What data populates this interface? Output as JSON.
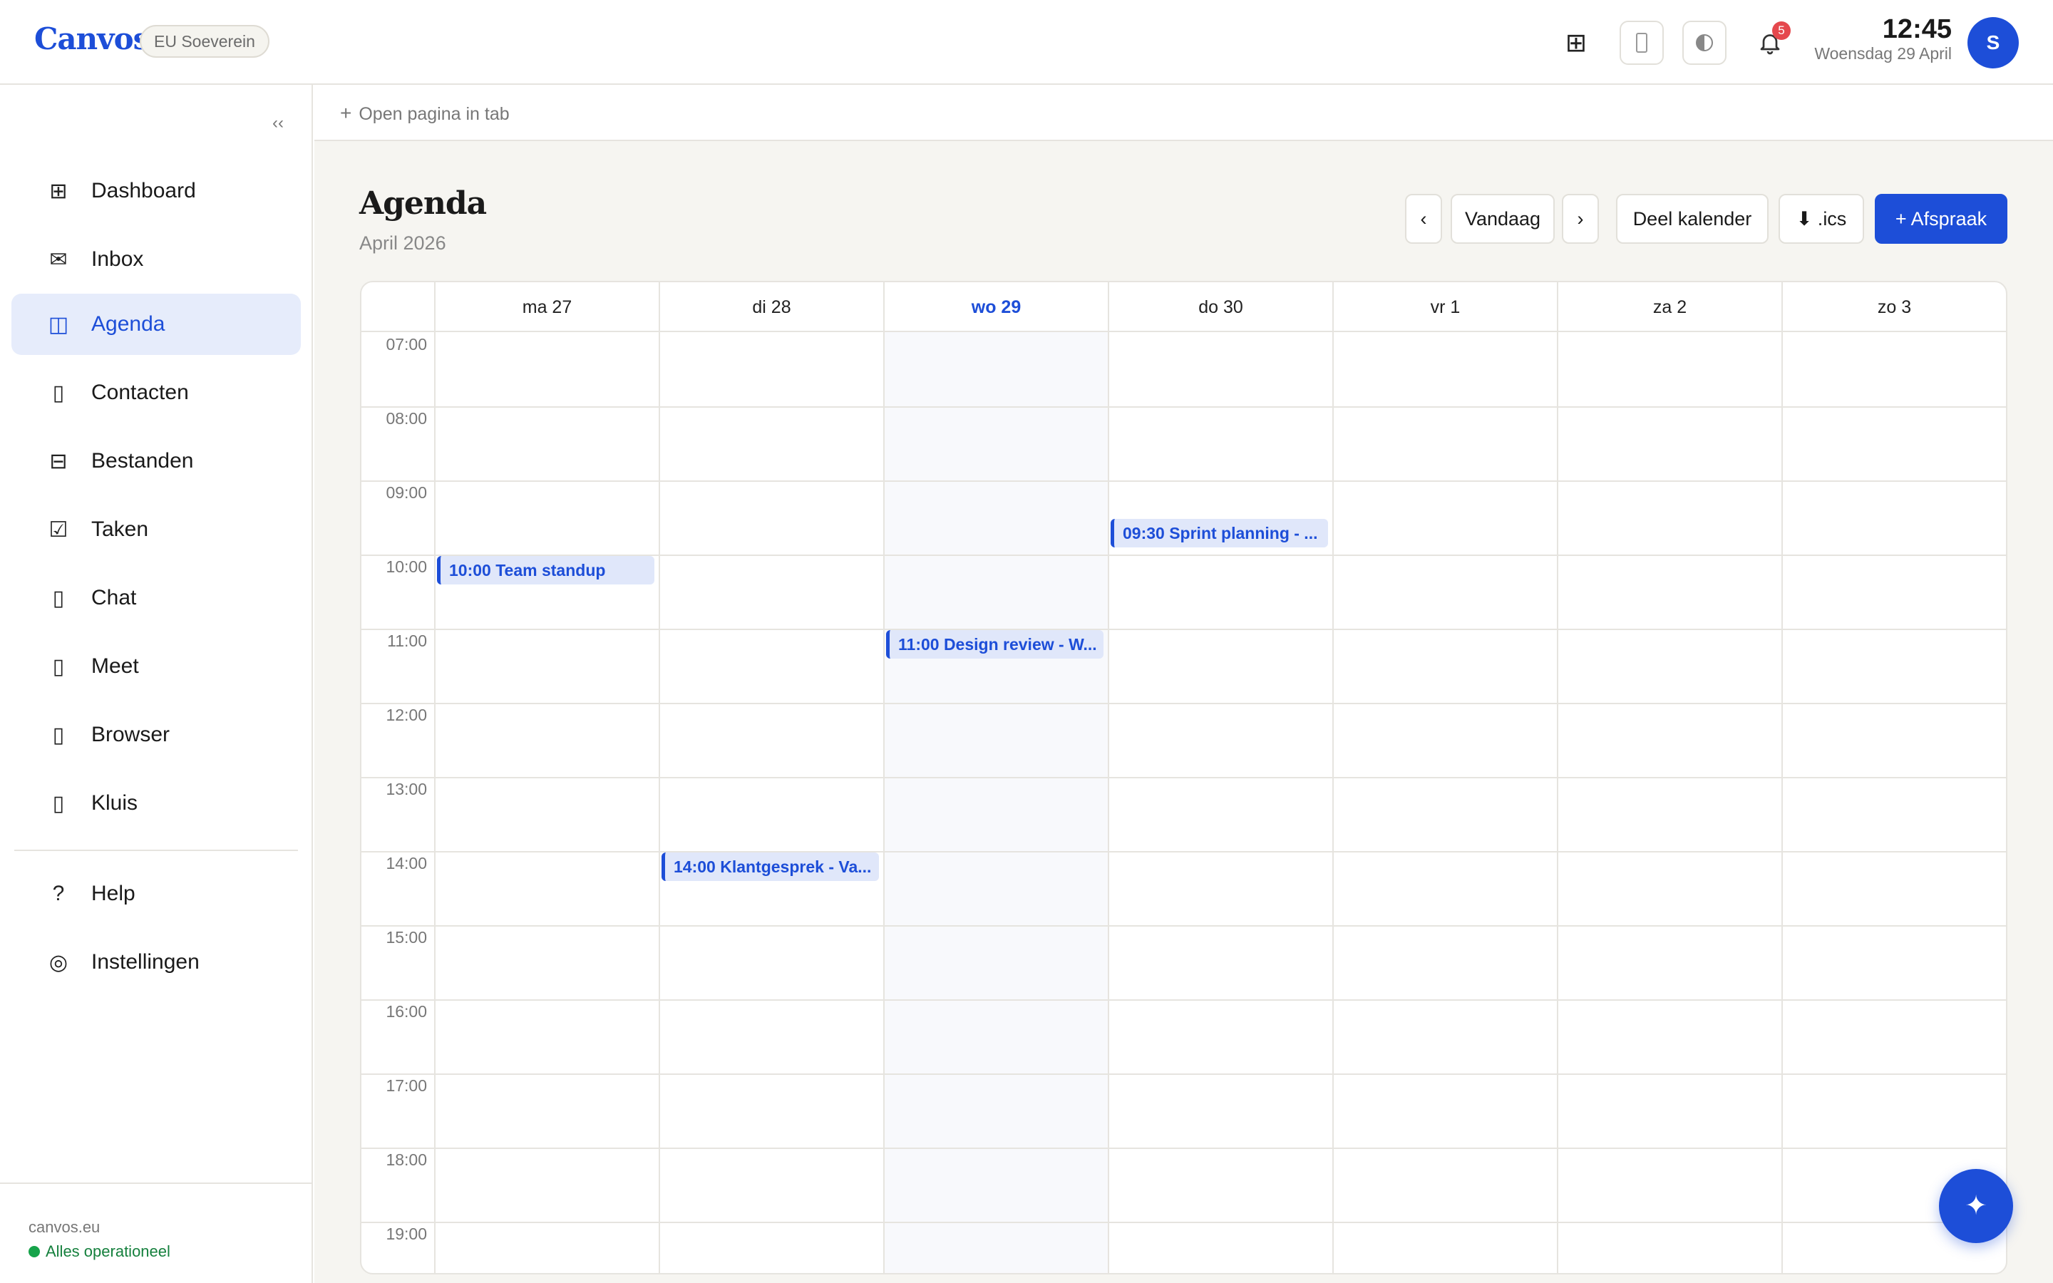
{
  "header": {
    "logo": "Canvos",
    "badge": "EU Soeverein",
    "notifications_count": "5",
    "time": "12:45",
    "date": "Woensdag 29 April",
    "avatar_initial": "S",
    "icons": {
      "grid": "grid-icon",
      "panel": "panel-icon",
      "contrast": "contrast-icon",
      "bell": "bell-icon"
    }
  },
  "sidebar": {
    "collapse_label": "‹‹",
    "items": [
      {
        "label": "Dashboard",
        "icon": "⊞",
        "icon_name": "dashboard-icon"
      },
      {
        "label": "Inbox",
        "icon": "✉",
        "icon_name": "mail-icon"
      },
      {
        "label": "Agenda",
        "icon": "◫",
        "icon_name": "calendar-icon",
        "active": true
      },
      {
        "label": "Contacten",
        "icon": "▯",
        "icon_name": "contacts-icon"
      },
      {
        "label": "Bestanden",
        "icon": "⊟",
        "icon_name": "files-icon"
      },
      {
        "label": "Taken",
        "icon": "☑",
        "icon_name": "tasks-icon"
      },
      {
        "label": "Chat",
        "icon": "▯",
        "icon_name": "chat-icon"
      },
      {
        "label": "Meet",
        "icon": "▯",
        "icon_name": "meet-icon"
      },
      {
        "label": "Browser",
        "icon": "▯",
        "icon_name": "browser-icon"
      },
      {
        "label": "Kluis",
        "icon": "▯",
        "icon_name": "vault-icon"
      }
    ],
    "secondary": [
      {
        "label": "Help",
        "icon": "?",
        "icon_name": "help-icon"
      },
      {
        "label": "Instellingen",
        "icon": "◎",
        "icon_name": "settings-icon"
      }
    ],
    "footer": {
      "domain": "canvos.eu",
      "status": "Alles operationeel"
    }
  },
  "tabbar": {
    "open_tab": "Open pagina in tab"
  },
  "page": {
    "title": "Agenda",
    "subtitle": "April 2026",
    "buttons": {
      "prev": "‹",
      "today": "Vandaag",
      "next": "›",
      "share": "Deel kalender",
      "ics": "⬇ .ics",
      "new": "+ Afspraak"
    }
  },
  "calendar": {
    "days": [
      "ma 27",
      "di 28",
      "wo 29",
      "do 30",
      "vr 1",
      "za 2",
      "zo 3"
    ],
    "today_index": 2,
    "hours": [
      "07:00",
      "08:00",
      "09:00",
      "10:00",
      "11:00",
      "12:00",
      "13:00",
      "14:00",
      "15:00",
      "16:00",
      "17:00",
      "18:00",
      "19:00"
    ],
    "events": [
      {
        "day": 0,
        "start": "10:00",
        "label": "10:00 Team standup"
      },
      {
        "day": 1,
        "start": "14:00",
        "label": "14:00 Klantgesprek - Va..."
      },
      {
        "day": 2,
        "start": "11:00",
        "label": "11:00 Design review - W..."
      },
      {
        "day": 3,
        "start": "09:30",
        "label": "09:30 Sprint planning - ..."
      }
    ]
  },
  "fab": {
    "icon": "✦",
    "icon_name": "sparkle-icon"
  },
  "colors": {
    "accent": "#1d4ed8",
    "background": "#f6f5f1",
    "event_bg": "#e0e7fa",
    "status_green": "#15803d",
    "badge_red": "#e5484d"
  }
}
